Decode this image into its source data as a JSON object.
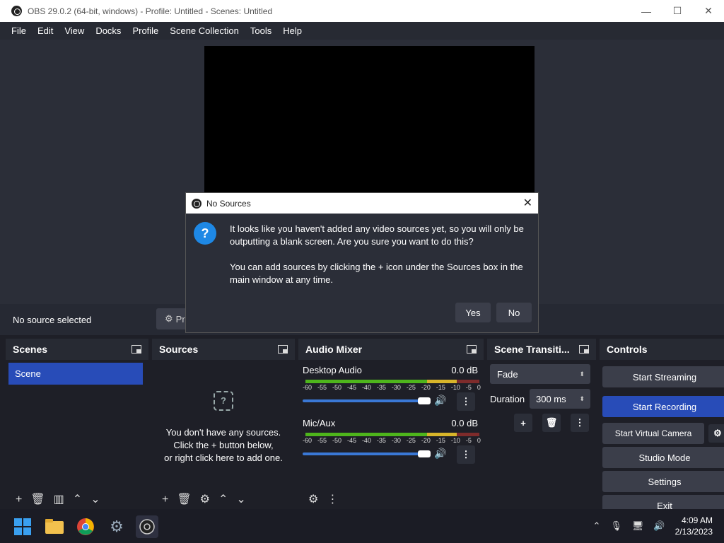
{
  "window": {
    "title": "OBS 29.0.2 (64-bit, windows) - Profile: Untitled - Scenes: Untitled",
    "min": "—",
    "max": "☐",
    "close": "✕"
  },
  "menu": [
    "File",
    "Edit",
    "View",
    "Docks",
    "Profile",
    "Scene Collection",
    "Tools",
    "Help"
  ],
  "context": {
    "no_source": "No source selected",
    "properties": "Pr"
  },
  "scenes": {
    "title": "Scenes",
    "items": [
      "Scene"
    ],
    "tools": [
      "+",
      "🗑",
      "▥",
      "⌃",
      "⌄"
    ]
  },
  "sources": {
    "title": "Sources",
    "empty_icon": "?",
    "empty_l1": "You don't have any sources.",
    "empty_l2": "Click the + button below,",
    "empty_l3": "or right click here to add one.",
    "tools": [
      "+",
      "🗑",
      "⚙",
      "⌃",
      "⌄"
    ]
  },
  "mixer": {
    "title": "Audio Mixer",
    "ticks": [
      "-60",
      "-55",
      "-50",
      "-45",
      "-40",
      "-35",
      "-30",
      "-25",
      "-20",
      "-15",
      "-10",
      "-5",
      "0"
    ],
    "channels": [
      {
        "name": "Desktop Audio",
        "db": "0.0 dB",
        "volume": 1.0
      },
      {
        "name": "Mic/Aux",
        "db": "0.0 dB",
        "volume": 1.0
      }
    ],
    "tools": [
      "⚙",
      "⋮"
    ]
  },
  "transitions": {
    "title": "Scene Transiti...",
    "type": "Fade",
    "duration_label": "Duration",
    "duration_value": "300 ms",
    "add": "+",
    "remove": "🗑",
    "more": "⋮"
  },
  "controls": {
    "title": "Controls",
    "start_streaming": "Start Streaming",
    "start_recording": "Start Recording",
    "start_virtual_camera": "Start Virtual Camera",
    "studio_mode": "Studio Mode",
    "settings": "Settings",
    "exit": "Exit"
  },
  "dialog": {
    "title": "No Sources",
    "close": "✕",
    "icon": "?",
    "message1": "It looks like you haven't added any video sources yet, so you will only be outputting a blank screen. Are you sure you want to do this?",
    "message2": "You can add sources by clicking the + icon under the Sources box in the main window at any time.",
    "yes": "Yes",
    "no": "No"
  },
  "taskbar": {
    "time": "4:09 AM",
    "date": "2/13/2023"
  },
  "colors": {
    "accent": "#284cb8",
    "dialog_icon": "#1e88e5"
  }
}
